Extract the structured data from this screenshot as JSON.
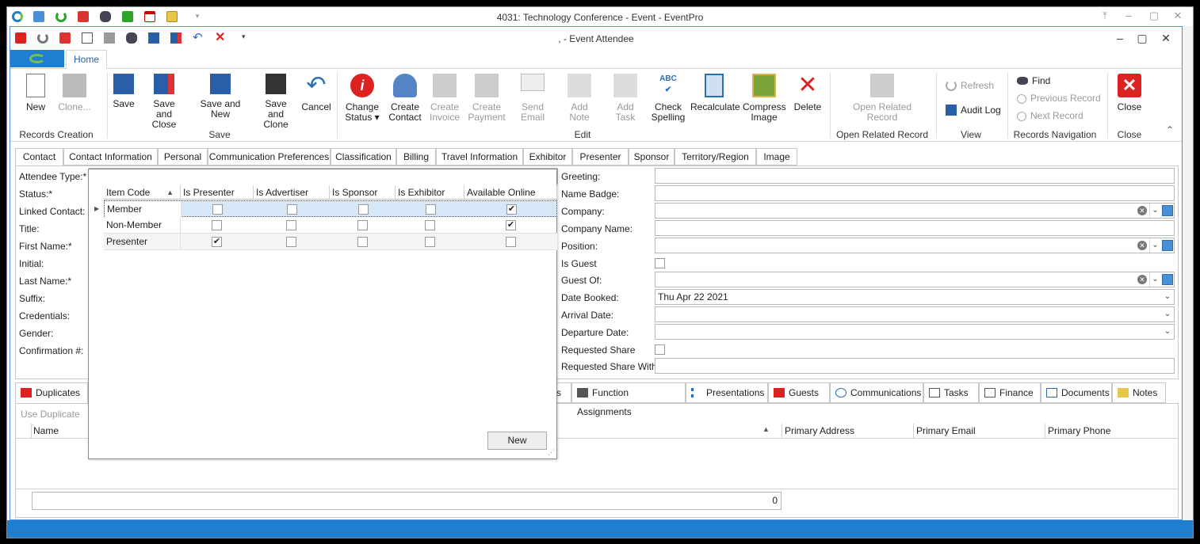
{
  "outer_window": {
    "title": "4031: Technology Conference - Event - EventPro"
  },
  "window": {
    "title": ", - Event Attendee"
  },
  "ribbon": {
    "tab_home": "Home",
    "groups": {
      "records_creation": "Records Creation",
      "save": "Save",
      "edit": "Edit",
      "open_related": "Open Related Record",
      "view": "View",
      "records_navigation": "Records Navigation",
      "close": "Close"
    },
    "buttons": {
      "new": "New",
      "clone": "Clone...",
      "save": "Save",
      "save_and_close_1": "Save and",
      "save_and_close_2": "Close",
      "save_and_new": "Save and New",
      "save_and_clone_1": "Save and",
      "save_and_clone_2": "Clone",
      "cancel": "Cancel",
      "change_status_1": "Change",
      "change_status_2": "Status",
      "create_contact_1": "Create",
      "create_contact_2": "Contact",
      "create_invoice_1": "Create",
      "create_invoice_2": "Invoice",
      "create_payment_1": "Create",
      "create_payment_2": "Payment",
      "send_email": "Send Email",
      "add_note": "Add Note",
      "add_task": "Add Task",
      "check_spelling_1": "Check",
      "check_spelling_2": "Spelling",
      "recalculate": "Recalculate",
      "compress_image_1": "Compress",
      "compress_image_2": "Image",
      "delete": "Delete",
      "open_related_record_1": "Open Related",
      "open_related_record_2": "Record",
      "refresh": "Refresh",
      "audit_log": "Audit Log",
      "find": "Find",
      "previous_record": "Previous Record",
      "next_record": "Next Record",
      "close": "Close"
    }
  },
  "form_tabs": [
    "Contact",
    "Contact Information",
    "Personal",
    "Communication Preferences",
    "Classification",
    "Billing",
    "Travel Information",
    "Exhibitor",
    "Presenter",
    "Sponsor",
    "Territory/Region",
    "Image"
  ],
  "left_fields": {
    "attendee_type": "Attendee Type:*",
    "status": "Status:*",
    "linked_contact": "Linked Contact:",
    "title": "Title:",
    "first_name": "First Name:*",
    "initial": "Initial:",
    "last_name": "Last Name:*",
    "suffix": "Suffix:",
    "credentials": "Credentials:",
    "gender": "Gender:",
    "confirmation": "Confirmation #:"
  },
  "right_fields": {
    "greeting": "Greeting:",
    "name_badge": "Name Badge:",
    "company": "Company:",
    "company_name": "Company Name:",
    "position": "Position:",
    "is_guest": "Is Guest",
    "guest_of": "Guest Of:",
    "date_booked": "Date Booked:",
    "date_booked_value": "Thu Apr 22 2021",
    "arrival_date": "Arrival Date:",
    "departure_date": "Departure Date:",
    "requested_share": "Requested Share",
    "requested_share_with": "Requested Share With:"
  },
  "dropdown_popup": {
    "columns": [
      "Item Code",
      "Is Presenter",
      "Is Advertiser",
      "Is Sponsor",
      "Is Exhibitor",
      "Available Online"
    ],
    "rows": [
      {
        "code": "Member",
        "presenter": false,
        "advertiser": false,
        "sponsor": false,
        "exhibitor": false,
        "online": true
      },
      {
        "code": "Non-Member",
        "presenter": false,
        "advertiser": false,
        "sponsor": false,
        "exhibitor": false,
        "online": true
      },
      {
        "code": "Presenter",
        "presenter": true,
        "advertiser": false,
        "sponsor": false,
        "exhibitor": false,
        "online": false
      }
    ],
    "new_button": "New"
  },
  "bottom_tabs": {
    "duplicates": "Duplicates",
    "partial": "s",
    "function_assignments": "Function Assignments",
    "presentations": "Presentations",
    "guests": "Guests",
    "communications": "Communications",
    "tasks": "Tasks",
    "finance": "Finance",
    "documents": "Documents",
    "notes": "Notes"
  },
  "duplicates_panel": {
    "use_duplicate": "Use Duplicate",
    "col_name": "Name",
    "col_primary_address": "Primary Address",
    "col_primary_email": "Primary Email",
    "col_primary_phone": "Primary Phone",
    "count": "0"
  },
  "colors": {
    "accent": "#1e7fd0",
    "selection": "#d6e8f8"
  }
}
